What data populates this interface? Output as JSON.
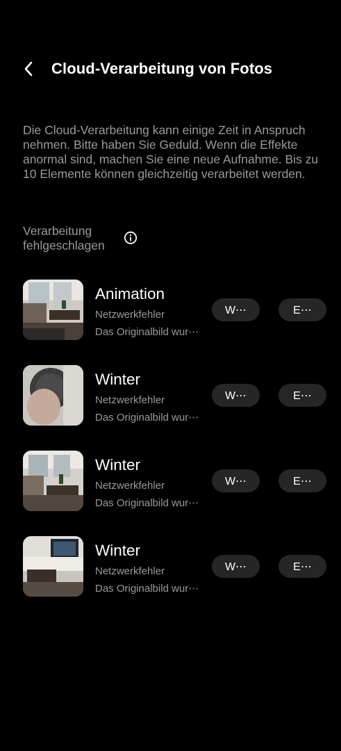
{
  "header": {
    "title": "Cloud-Verarbeitung von Fotos",
    "back_icon": "chevron-left-icon"
  },
  "description": "Die Cloud-Verarbeitung kann einige Zeit in Anspruch nehmen. Bitte haben Sie Geduld. Wenn die Effekte anormal sind, machen Sie eine neue Aufnahme. Bis zu 10 Elemente können gleichzeitig verarbeitet werden.",
  "section": {
    "label": "Verarbeitung fehlgeschlagen",
    "icon": "info-icon"
  },
  "items": [
    {
      "title": "Animation",
      "status": "Netzwerkfehler",
      "subtitle": "Das Originalbild wur⋯",
      "retry_label": "W⋯",
      "delete_label": "E⋯"
    },
    {
      "title": "Winter",
      "status": "Netzwerkfehler",
      "subtitle": "Das Originalbild wur⋯",
      "retry_label": "W⋯",
      "delete_label": "E⋯"
    },
    {
      "title": "Winter",
      "status": "Netzwerkfehler",
      "subtitle": "Das Originalbild wur⋯",
      "retry_label": "W⋯",
      "delete_label": "E⋯"
    },
    {
      "title": "Winter",
      "status": "Netzwerkfehler",
      "subtitle": "Das Originalbild wur⋯",
      "retry_label": "W⋯",
      "delete_label": "E⋯"
    }
  ],
  "colors": {
    "background": "#000000",
    "text_primary": "#ffffff",
    "text_secondary": "#9a9a9a",
    "button_bg": "#262626"
  }
}
